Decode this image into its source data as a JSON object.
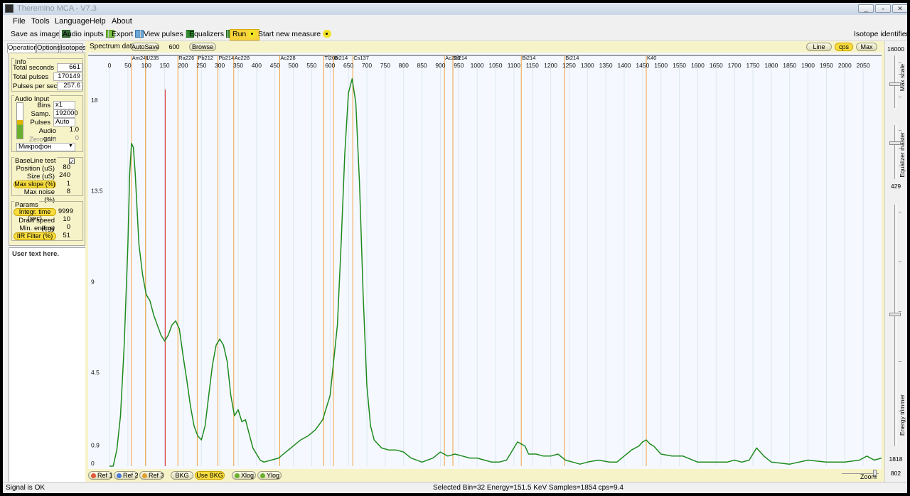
{
  "window": {
    "title": "Theremino MCA - V7.3",
    "controls": [
      "_",
      "▫",
      "✕"
    ]
  },
  "menu": [
    "File",
    "Tools",
    "Language",
    "Help",
    "About"
  ],
  "toolbar": {
    "save_image": "Save as image",
    "audio_inputs": "Audio inputs",
    "export": "Export",
    "view_pulses": "View pulses",
    "equalizers": "Equalizers",
    "run": "Run",
    "start_new": "Start new measure",
    "isotope_identifier": "Isotope identifier"
  },
  "tabs": [
    "Operation",
    "Options",
    "Isotopes"
  ],
  "info": {
    "title": "Info",
    "total_seconds_label": "Total seconds",
    "total_seconds": "661",
    "total_pulses_label": "Total pulses",
    "total_pulses": "170149",
    "pps_label": "Pulses per sec.",
    "pps": "257.6"
  },
  "audio_input": {
    "title": "Audio Input",
    "bins_label": "Bins",
    "bins": "x1",
    "samp_label": "Samp.",
    "samp": "192000",
    "pulses_label": "Pulses",
    "pulses": "Auto",
    "gain_label": "Audio gain",
    "gain": "1.0",
    "zero_trim_label": "Zero trim",
    "zero_trim": "0",
    "device": "Микрофон"
  },
  "baseline": {
    "title": "BaseLine test",
    "position_label": "Position (uS)",
    "position": "80",
    "size_label": "Size (uS)",
    "size": "240",
    "max_slope_label": "Max slope (%)",
    "max_slope": "1",
    "max_noise_label": "Max noise (%)",
    "max_noise": "8"
  },
  "params": {
    "title": "Params",
    "integr_label": "Integr. time (sec)",
    "integr": "9999",
    "draw_speed_label": "Draw speed (fps)",
    "draw_speed": "10",
    "min_energy_label": "Min. energy (KeV)",
    "min_energy": "0",
    "iir_label": "IIR Filter (%)",
    "iir": "51"
  },
  "user_text": "User text here.",
  "spectrum_header": {
    "label": "Spectrum data",
    "autosave": "AutoSave",
    "autosave_value": "600",
    "browse": "Browse",
    "line": "Line",
    "cps": "cps",
    "max": "Max"
  },
  "right_panel": {
    "top_value": "16000",
    "max_scale": "Max scale",
    "equalizer_master": "Equalizer master",
    "eq_value": "429",
    "energy_trimmer": "Energy trimmer",
    "energy_value": "1818",
    "zoom_value": "802",
    "zoom_label": "Zoom"
  },
  "bottom_buttons": {
    "ref1": "Ref 1",
    "ref2": "Ref 2",
    "ref3": "Ref 3",
    "bkg": "BKG",
    "use_bkg": "Use BKG",
    "xlog": "Xlog",
    "ylog": "Ylog"
  },
  "status": {
    "signal": "Signal is OK",
    "selection": "Selected Bin=32  Energy=151.5 KeV  Samples=1854  cps=9.4"
  },
  "chart_data": {
    "type": "line",
    "xlabel": "",
    "ylabel": "",
    "xlim": [
      0,
      2100
    ],
    "ylim": [
      0,
      20.5
    ],
    "x_ticks": [
      0,
      50,
      100,
      150,
      200,
      250,
      300,
      350,
      400,
      450,
      500,
      550,
      600,
      650,
      700,
      750,
      800,
      850,
      900,
      950,
      1000,
      1050,
      1100,
      1150,
      1200,
      1250,
      1300,
      1350,
      1400,
      1450,
      1500,
      1550,
      1600,
      1650,
      1700,
      1750,
      1800,
      1850,
      1900,
      1950,
      2000,
      2050
    ],
    "y_ticks": [
      0,
      0.9,
      4.5,
      9,
      13.5,
      18
    ],
    "y_tick_labels": [
      "0",
      "0.9",
      "4.5",
      "9",
      "13.5",
      "18"
    ],
    "selected_energy": 151.5,
    "isotope_markers": [
      {
        "name": "Am241",
        "energy": 59.5
      },
      {
        "name": "U235",
        "energy": 98
      },
      {
        "name": "Ra226",
        "energy": 186
      },
      {
        "name": "Pb212",
        "energy": 238.6
      },
      {
        "name": "Pb214",
        "energy": 295
      },
      {
        "name": "Ac228",
        "energy": 338
      },
      {
        "name": "Ac228",
        "energy": 463
      },
      {
        "name": "Tl208",
        "energy": 583
      },
      {
        "name": "Bi214",
        "energy": 609
      },
      {
        "name": "Cs137",
        "energy": 661.7
      },
      {
        "name": "Ac228",
        "energy": 911
      },
      {
        "name": "Bi214",
        "energy": 934
      },
      {
        "name": "Bi214",
        "energy": 1120
      },
      {
        "name": "Bi214",
        "energy": 1238
      },
      {
        "name": "K40",
        "energy": 1460
      }
    ],
    "series": [
      {
        "color": "#1e8a1e",
        "points": [
          [
            0,
            0
          ],
          [
            10,
            0
          ],
          [
            20,
            0.8
          ],
          [
            30,
            2.5
          ],
          [
            40,
            6
          ],
          [
            50,
            11
          ],
          [
            55,
            14.5
          ],
          [
            60,
            16
          ],
          [
            65,
            15.8
          ],
          [
            70,
            14.5
          ],
          [
            80,
            11
          ],
          [
            90,
            9.5
          ],
          [
            100,
            8.5
          ],
          [
            110,
            8.2
          ],
          [
            120,
            7.5
          ],
          [
            130,
            7
          ],
          [
            140,
            6.5
          ],
          [
            150,
            6.2
          ],
          [
            160,
            6.5
          ],
          [
            170,
            7
          ],
          [
            180,
            7.2
          ],
          [
            190,
            6.8
          ],
          [
            200,
            5.5
          ],
          [
            210,
            4.3
          ],
          [
            220,
            3
          ],
          [
            230,
            2
          ],
          [
            240,
            1.5
          ],
          [
            250,
            1.3
          ],
          [
            260,
            2
          ],
          [
            270,
            3.5
          ],
          [
            280,
            5
          ],
          [
            290,
            6
          ],
          [
            300,
            6.3
          ],
          [
            310,
            6
          ],
          [
            320,
            5.2
          ],
          [
            330,
            3.5
          ],
          [
            340,
            2.5
          ],
          [
            350,
            2.8
          ],
          [
            360,
            2.2
          ],
          [
            370,
            2.3
          ],
          [
            380,
            1.6
          ],
          [
            390,
            0.9
          ],
          [
            400,
            0.6
          ],
          [
            410,
            0.3
          ],
          [
            420,
            0.2
          ],
          [
            440,
            0.3
          ],
          [
            460,
            0.4
          ],
          [
            480,
            0.7
          ],
          [
            500,
            1
          ],
          [
            520,
            1.3
          ],
          [
            540,
            1.5
          ],
          [
            560,
            1.8
          ],
          [
            580,
            2.3
          ],
          [
            600,
            3.5
          ],
          [
            620,
            7
          ],
          [
            630,
            11
          ],
          [
            640,
            15.5
          ],
          [
            650,
            18.5
          ],
          [
            660,
            19.2
          ],
          [
            670,
            18
          ],
          [
            680,
            14
          ],
          [
            690,
            8.5
          ],
          [
            700,
            4
          ],
          [
            710,
            2
          ],
          [
            720,
            1.3
          ],
          [
            740,
            0.9
          ],
          [
            760,
            0.8
          ],
          [
            780,
            0.8
          ],
          [
            800,
            0.7
          ],
          [
            820,
            0.4
          ],
          [
            850,
            0.2
          ],
          [
            880,
            0.4
          ],
          [
            900,
            0.7
          ],
          [
            920,
            0.5
          ],
          [
            940,
            0.6
          ],
          [
            960,
            0.5
          ],
          [
            980,
            0.4
          ],
          [
            1000,
            0.4
          ],
          [
            1020,
            0.3
          ],
          [
            1040,
            0.2
          ],
          [
            1060,
            0.2
          ],
          [
            1080,
            0.3
          ],
          [
            1100,
            0.9
          ],
          [
            1110,
            1.2
          ],
          [
            1120,
            1.1
          ],
          [
            1130,
            1
          ],
          [
            1140,
            0.6
          ],
          [
            1160,
            0.6
          ],
          [
            1180,
            0.5
          ],
          [
            1200,
            0.5
          ],
          [
            1220,
            0.6
          ],
          [
            1240,
            0.3
          ],
          [
            1260,
            0.2
          ],
          [
            1280,
            0.1
          ],
          [
            1300,
            0.2
          ],
          [
            1330,
            0.3
          ],
          [
            1360,
            0.2
          ],
          [
            1380,
            0.2
          ],
          [
            1400,
            0.5
          ],
          [
            1420,
            0.8
          ],
          [
            1440,
            1
          ],
          [
            1450,
            1.2
          ],
          [
            1460,
            1.3
          ],
          [
            1470,
            1.1
          ],
          [
            1480,
            1.0
          ],
          [
            1500,
            0.6
          ],
          [
            1530,
            0.5
          ],
          [
            1560,
            0.5
          ],
          [
            1600,
            0.2
          ],
          [
            1640,
            0.2
          ],
          [
            1680,
            0.2
          ],
          [
            1700,
            0.3
          ],
          [
            1720,
            0.2
          ],
          [
            1740,
            0.3
          ],
          [
            1760,
            0.9
          ],
          [
            1780,
            0.5
          ],
          [
            1800,
            0.2
          ],
          [
            1850,
            0.1
          ],
          [
            1900,
            0.3
          ],
          [
            1950,
            0.2
          ],
          [
            2000,
            0.2
          ],
          [
            2040,
            0.3
          ],
          [
            2060,
            0.5
          ],
          [
            2080,
            0.3
          ],
          [
            2100,
            0.4
          ]
        ]
      }
    ]
  }
}
